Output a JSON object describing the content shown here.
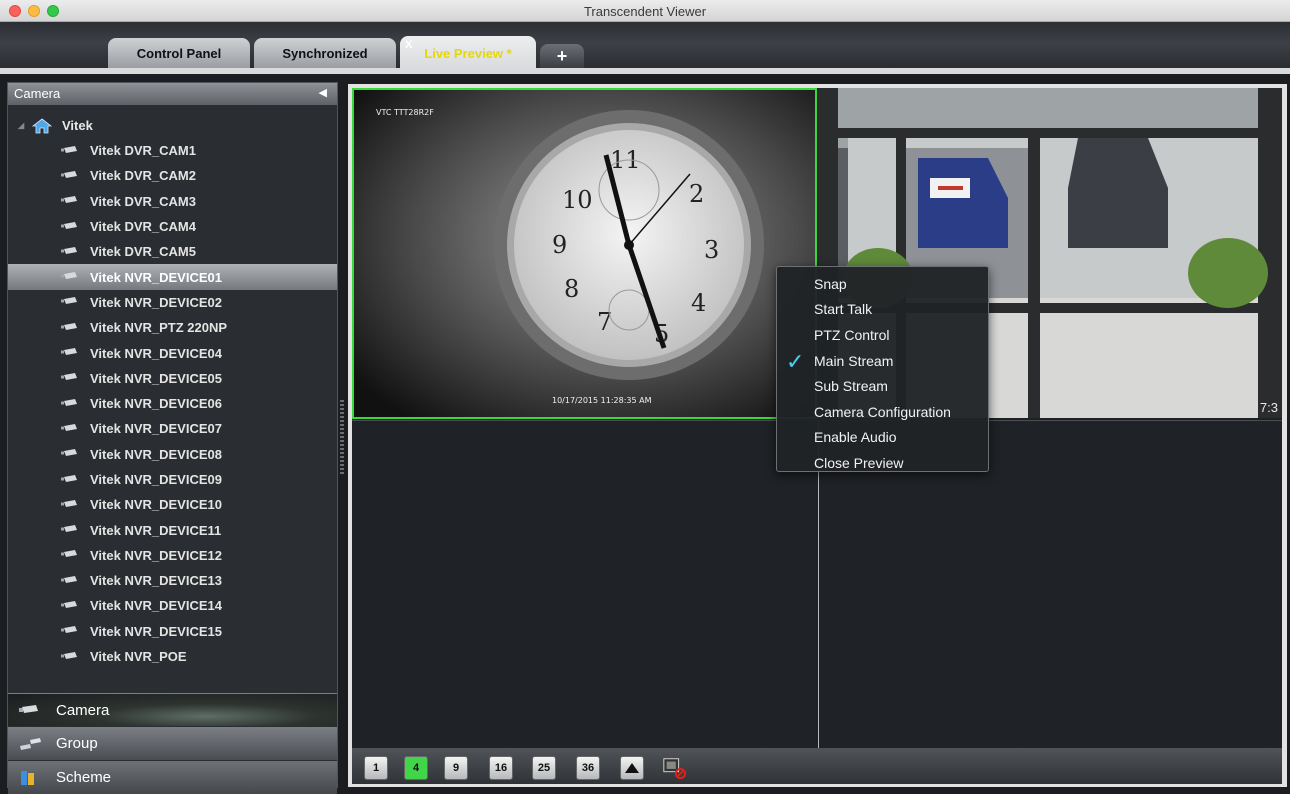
{
  "window": {
    "title": "Transcendent Viewer"
  },
  "tabs": [
    {
      "label": "Control Panel"
    },
    {
      "label": "Synchronized"
    },
    {
      "label": "Live Preview *",
      "close": "X"
    },
    {
      "label": "+"
    }
  ],
  "left_panel": {
    "header": "Camera",
    "collapse_arrow": "◀",
    "root": "Vitek",
    "devices": [
      "Vitek DVR_CAM1",
      "Vitek DVR_CAM2",
      "Vitek DVR_CAM3",
      "Vitek DVR_CAM4",
      "Vitek DVR_CAM5",
      "Vitek NVR_DEVICE01",
      "Vitek NVR_DEVICE02",
      "Vitek NVR_PTZ 220NP",
      "Vitek NVR_DEVICE04",
      "Vitek NVR_DEVICE05",
      "Vitek NVR_DEVICE06",
      "Vitek NVR_DEVICE07",
      "Vitek NVR_DEVICE08",
      "Vitek NVR_DEVICE09",
      "Vitek NVR_DEVICE10",
      "Vitek NVR_DEVICE11",
      "Vitek NVR_DEVICE12",
      "Vitek NVR_DEVICE13",
      "Vitek NVR_DEVICE14",
      "Vitek NVR_DEVICE15",
      "Vitek NVR_POE"
    ],
    "selected_device": "Vitek NVR_DEVICE01",
    "bottom_tabs": {
      "camera": "Camera",
      "group": "Group",
      "scheme": "Scheme"
    }
  },
  "preview": {
    "cell1": {
      "camera_name": "VTC TTT28R2F",
      "timestamp": "10/17/2015 11:28:35 AM"
    },
    "cell2": {
      "timestamp_partial": "7:3"
    }
  },
  "toolbar": {
    "layouts": [
      "1",
      "4",
      "9",
      "16",
      "25",
      "36"
    ],
    "active_layout": "4",
    "up_icon": "triangle-up-icon",
    "stop_icon": "stop-all-preview-icon"
  },
  "context_menu": {
    "items": [
      "Snap",
      "Start Talk",
      "PTZ Control",
      "Main Stream",
      "Sub Stream",
      "Camera Configuration",
      "Enable Audio",
      "Close Preview"
    ],
    "checked": "Main Stream",
    "check_glyph": "✓"
  },
  "colors": {
    "active_border": "#3ad93a",
    "check": "#4ccff0",
    "live_tab_text": "#e8d800"
  }
}
